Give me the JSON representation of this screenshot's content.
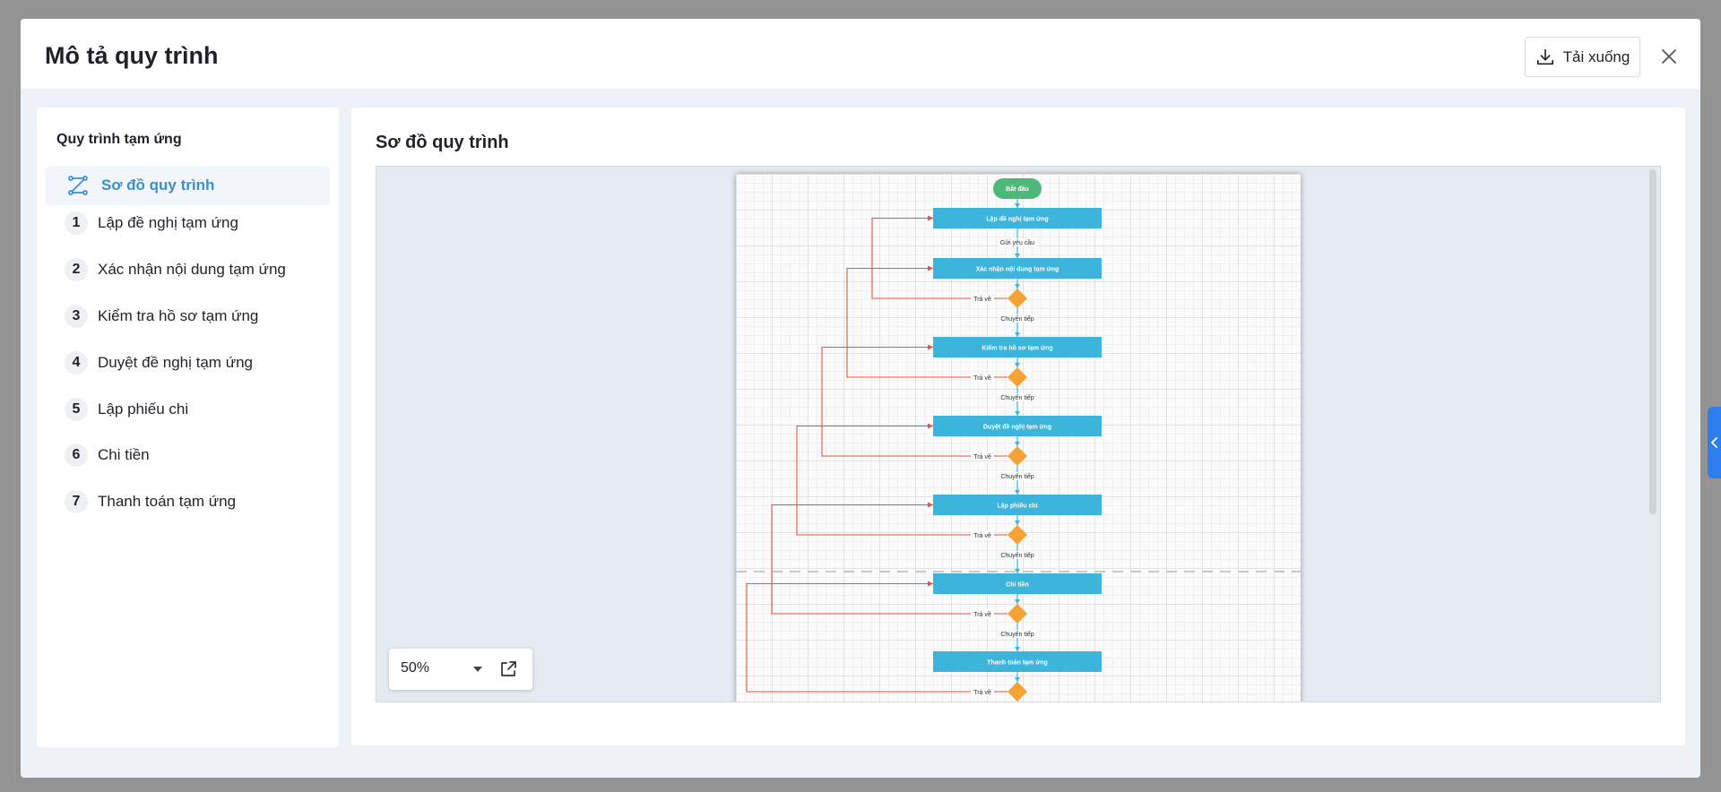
{
  "modal": {
    "title": "Mô tả quy trình",
    "download_label": "Tải xuống"
  },
  "sidebar": {
    "title": "Quy trình tạm ứng",
    "active_item": "Sơ đồ quy trình",
    "steps": [
      {
        "num": "1",
        "label": "Lập đề nghị tạm ứng"
      },
      {
        "num": "2",
        "label": "Xác nhận nội dung tạm ứng"
      },
      {
        "num": "3",
        "label": "Kiểm tra hồ sơ tạm ứng"
      },
      {
        "num": "4",
        "label": "Duyệt đề nghị tạm ứng"
      },
      {
        "num": "5",
        "label": "Lập phiếu chi"
      },
      {
        "num": "6",
        "label": "Chi tiền"
      },
      {
        "num": "7",
        "label": "Thanh toán tạm ứng"
      }
    ]
  },
  "content": {
    "title": "Sơ đồ quy trình"
  },
  "diagram": {
    "start_label": "Bắt đầu",
    "steps": [
      "Lập đề nghị tạm ứng",
      "Xác nhận nội dung tạm ứng",
      "Kiểm tra hồ sơ tạm ứng",
      "Duyệt đề nghị tạm ứng",
      "Lập phiếu chi",
      "Chi tiền",
      "Thanh toán tạm ứng"
    ],
    "send_label": "Gửi yêu cầu",
    "forward_label": "Chuyển tiếp",
    "return_label": "Trả về",
    "colors": {
      "start": "#4cb87a",
      "step": "#3db4dc",
      "decision": "#f7a234",
      "return_line": "#e8553d",
      "flow_line": "#3db4dc"
    }
  },
  "zoom": {
    "value": "50%"
  }
}
